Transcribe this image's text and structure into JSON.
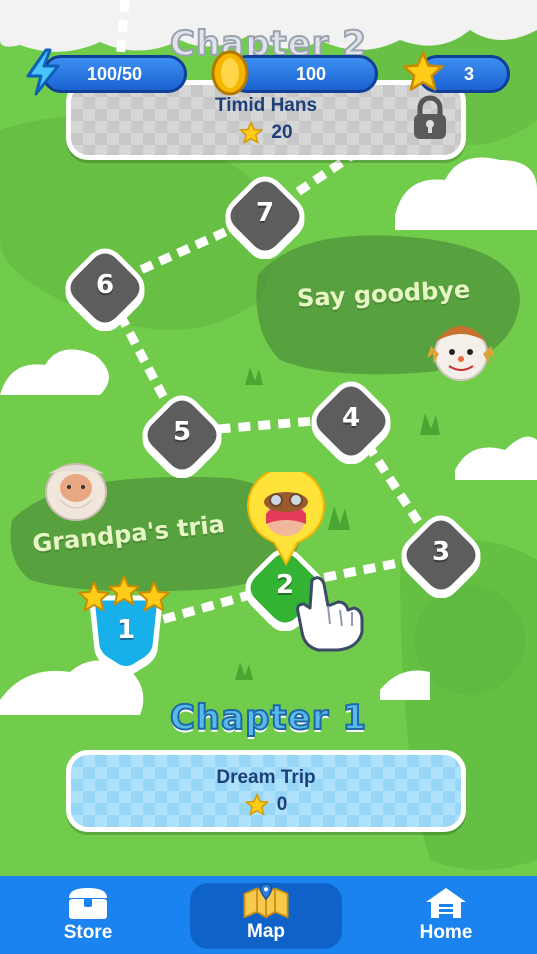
{
  "resources": {
    "energy": {
      "value": "100/50",
      "icon": "lightning-icon"
    },
    "coins": {
      "value": "100",
      "icon": "coin-icon"
    },
    "stars": {
      "value": "3",
      "icon": "star-icon"
    }
  },
  "chapters": [
    {
      "title": "Chapter 2",
      "card_title": "Timid Hans",
      "stars": "20",
      "locked": true
    },
    {
      "title": "Chapter 1",
      "card_title": "Dream Trip",
      "stars": "0",
      "locked": false
    }
  ],
  "regions": [
    {
      "label": "Say goodbye"
    },
    {
      "label": "Grandpa's tria"
    }
  ],
  "levels": [
    {
      "number": "1",
      "state": "completed",
      "stars_earned": 3
    },
    {
      "number": "2",
      "state": "current"
    },
    {
      "number": "3",
      "state": "locked"
    },
    {
      "number": "4",
      "state": "locked"
    },
    {
      "number": "5",
      "state": "locked"
    },
    {
      "number": "6",
      "state": "locked"
    },
    {
      "number": "7",
      "state": "locked"
    }
  ],
  "nav": {
    "store_label": "Store",
    "map_label": "Map",
    "home_label": "Home",
    "active": "Map"
  },
  "colors": {
    "grass": "#6cc84a",
    "level_locked": "#5d5d5d",
    "level_current": "#33b233",
    "level_completed": "#18b0ea",
    "nav_bar": "#1a83f0",
    "chapter_title": "#3aa6de"
  }
}
